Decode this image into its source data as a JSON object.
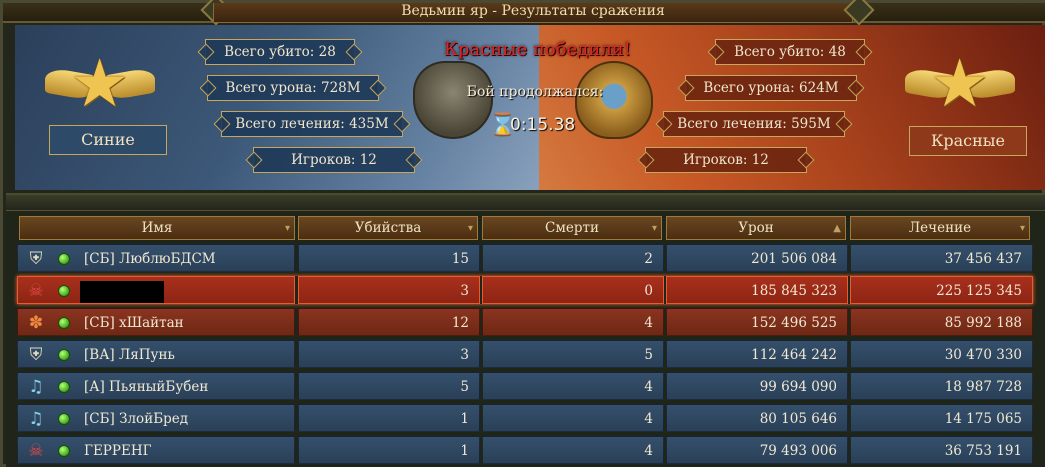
{
  "window": {
    "title": "Ведьмин яр - Результаты сражения"
  },
  "summary": {
    "result_text": "Красные победили!",
    "duration_label": "Бой продолжался:",
    "duration_value": "0:15.38",
    "blue": {
      "team_name": "Синие",
      "total_kills": "Всего убито: 28",
      "total_damage": "Всего урона: 728M",
      "total_healing": "Всего лечения: 435M",
      "players": "Игроков: 12"
    },
    "red": {
      "team_name": "Красные",
      "total_kills": "Всего убито: 48",
      "total_damage": "Всего урона: 624M",
      "total_healing": "Всего лечения: 595M",
      "players": "Игроков: 12"
    }
  },
  "table": {
    "columns": {
      "name": "Имя",
      "kills": "Убийства",
      "deaths": "Смерти",
      "damage": "Урон",
      "healing": "Лечение"
    },
    "sorted_column": "damage",
    "rows": [
      {
        "team": "blue",
        "icon": "knight-shield-icon",
        "name": "[СБ] ЛюблюБДСМ",
        "kills": "15",
        "deaths": "2",
        "damage": "201 506 084",
        "healing": "37 456 437"
      },
      {
        "team": "red",
        "icon": "skull-icon",
        "name": "",
        "redacted": true,
        "highlighted": true,
        "kills": "3",
        "deaths": "0",
        "damage": "185 845 323",
        "healing": "225 125 345"
      },
      {
        "team": "red",
        "icon": "paw-icon",
        "name": "[СБ] хШайтан",
        "kills": "12",
        "deaths": "4",
        "damage": "152 496 525",
        "healing": "85 992 188"
      },
      {
        "team": "blue",
        "icon": "knight-shield-icon",
        "name": "[ВА] ЛяПунь",
        "kills": "3",
        "deaths": "5",
        "damage": "112 464 242",
        "healing": "30 470 330"
      },
      {
        "team": "blue",
        "icon": "lute-icon",
        "name": "[А] ПьяныйБубен",
        "kills": "5",
        "deaths": "4",
        "damage": "99 694 090",
        "healing": "18 987 728"
      },
      {
        "team": "blue",
        "icon": "lute-icon",
        "name": "[СБ] ЗлойБред",
        "kills": "1",
        "deaths": "4",
        "damage": "80 105 646",
        "healing": "14 175 065"
      },
      {
        "team": "blue",
        "icon": "skull-icon",
        "name": "ГЕРРЕНГ",
        "kills": "1",
        "deaths": "4",
        "damage": "79 493 006",
        "healing": "36 753 191"
      }
    ]
  }
}
